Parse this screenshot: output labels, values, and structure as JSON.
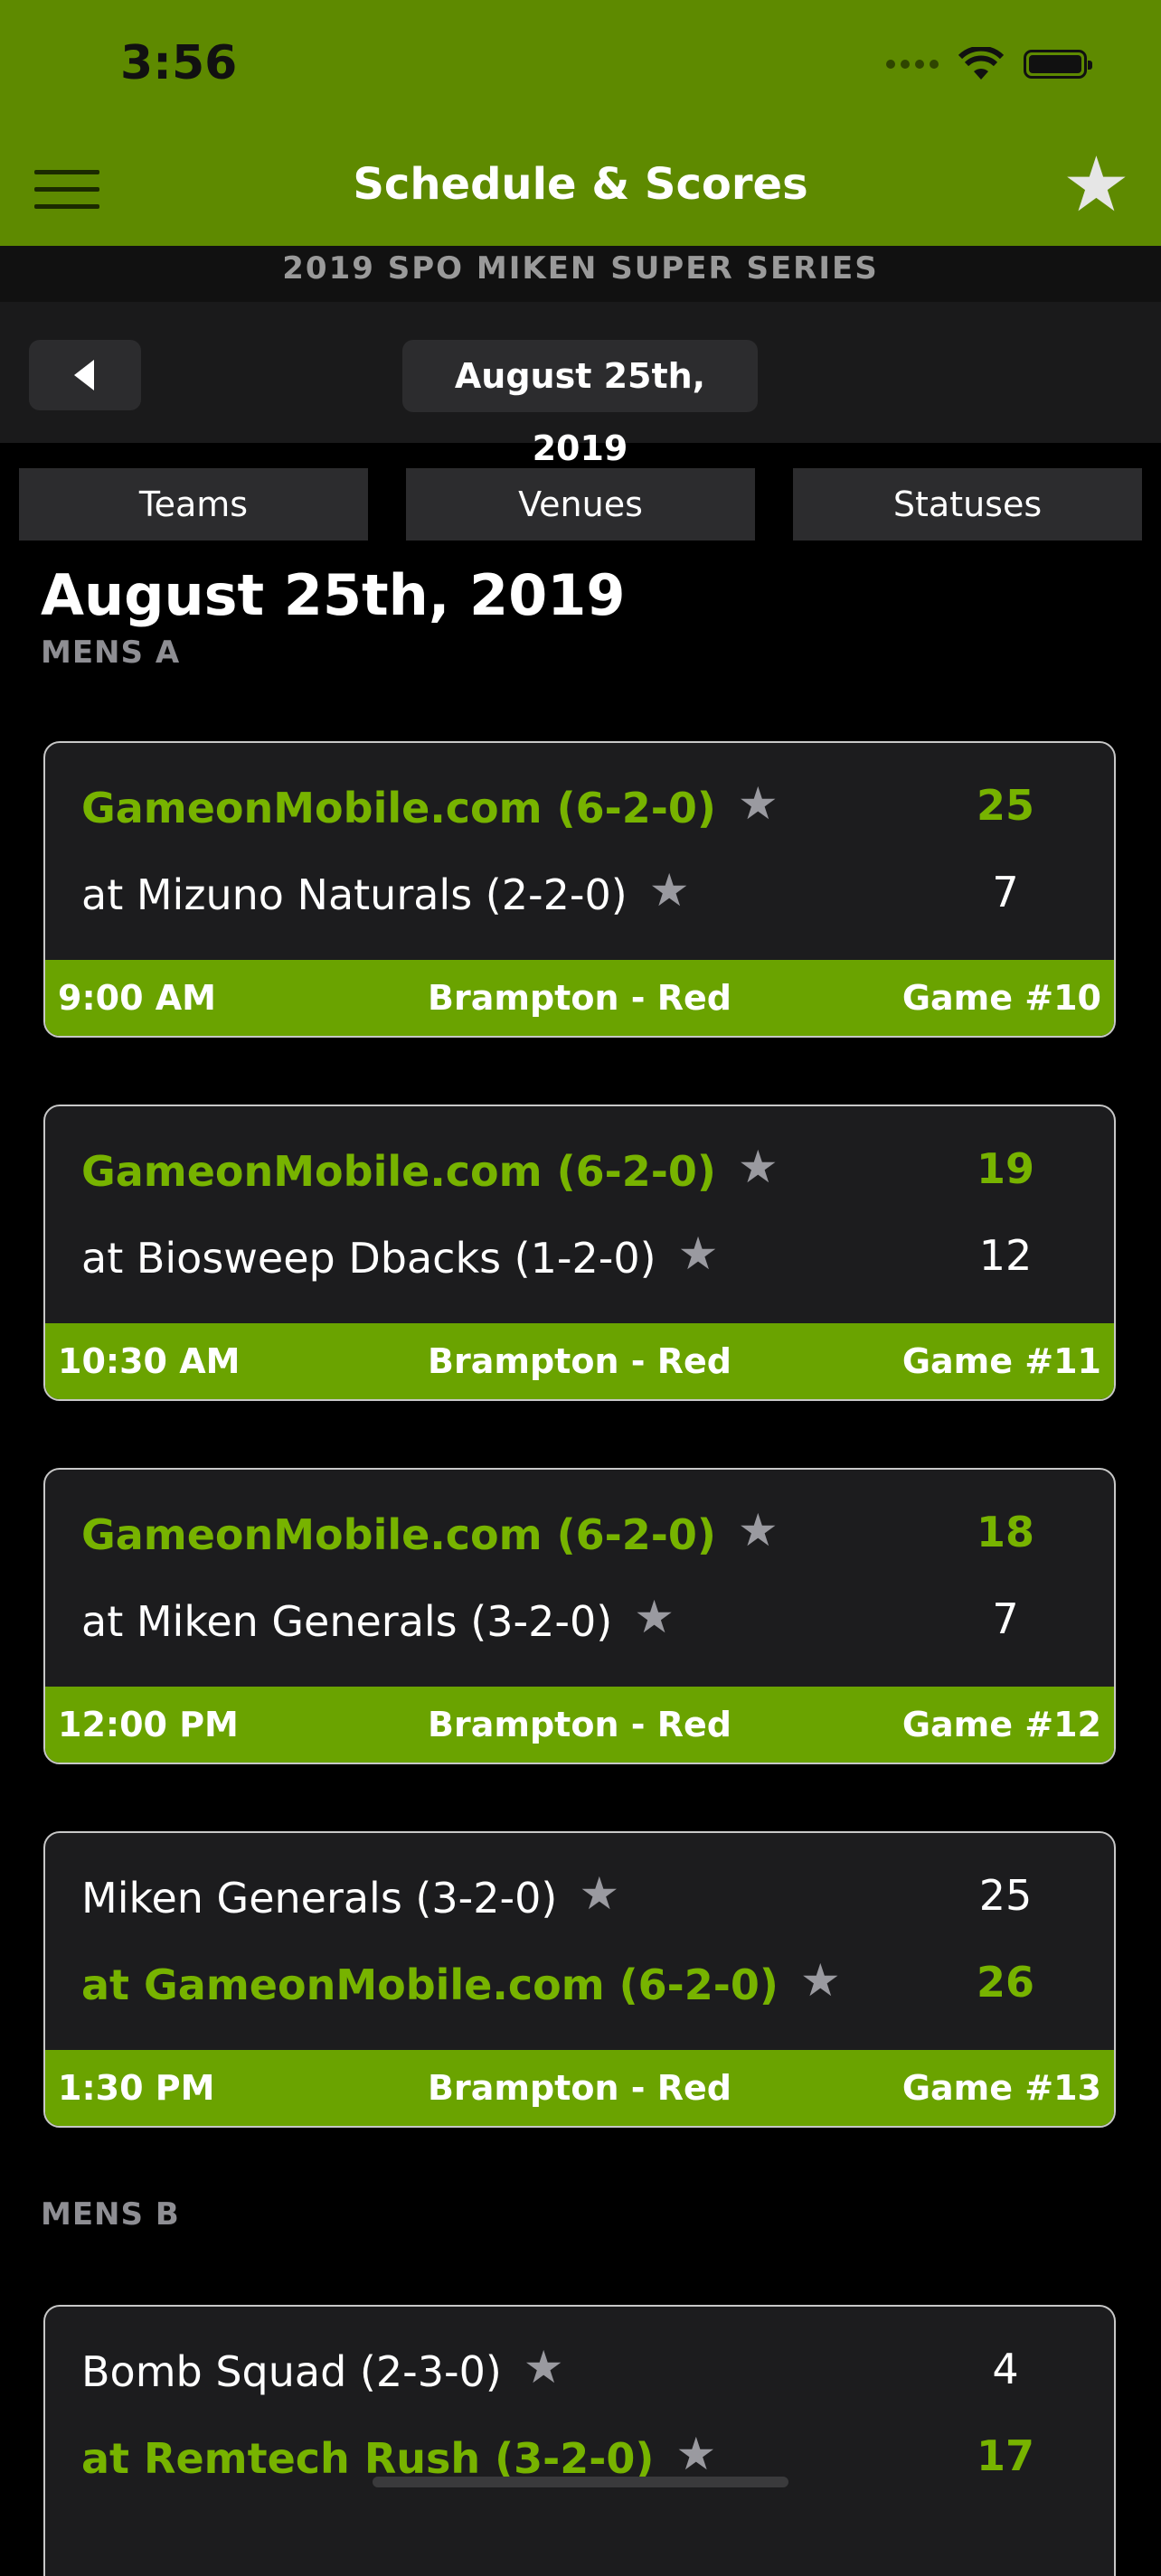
{
  "status": {
    "time": "3:56"
  },
  "nav": {
    "title": "Schedule & Scores"
  },
  "series": "2019 SPO MIKEN SUPER SERIES",
  "date_pill": "August 25th, 2019",
  "filters": [
    "Teams",
    "Venues",
    "Statuses"
  ],
  "section_date": "August 25th, 2019",
  "divisions": [
    "MENS A",
    "MENS B"
  ],
  "games": [
    {
      "top": {
        "name": "GameonMobile.com (6-2-0)",
        "score": "25"
      },
      "bottom": {
        "name": "at Mizuno Naturals (2-2-0)",
        "score": "7"
      },
      "time": "9:00 AM",
      "venue": "Brampton - Red",
      "game": "Game #10"
    },
    {
      "top": {
        "name": "GameonMobile.com (6-2-0)",
        "score": "19"
      },
      "bottom": {
        "name": "at Biosweep Dbacks (1-2-0)",
        "score": "12"
      },
      "time": "10:30 AM",
      "venue": "Brampton - Red",
      "game": "Game #11"
    },
    {
      "top": {
        "name": "GameonMobile.com (6-2-0)",
        "score": "18"
      },
      "bottom": {
        "name": "at Miken Generals (3-2-0)",
        "score": "7"
      },
      "time": "12:00 PM",
      "venue": "Brampton - Red",
      "game": "Game #12"
    },
    {
      "top": {
        "name": "Miken Generals (3-2-0)",
        "score": "25"
      },
      "bottom": {
        "name": "at GameonMobile.com (6-2-0)",
        "score": "26"
      },
      "time": "1:30 PM",
      "venue": "Brampton - Red",
      "game": "Game #13"
    },
    {
      "top": {
        "name": "Bomb Squad (2-3-0)",
        "score": "4"
      },
      "bottom": {
        "name": "at Remtech Rush (3-2-0)",
        "score": "17"
      }
    }
  ],
  "colors": {
    "header_green": "#5e8a00",
    "winner_green": "#77b300",
    "footer_green": "#6aa300"
  }
}
